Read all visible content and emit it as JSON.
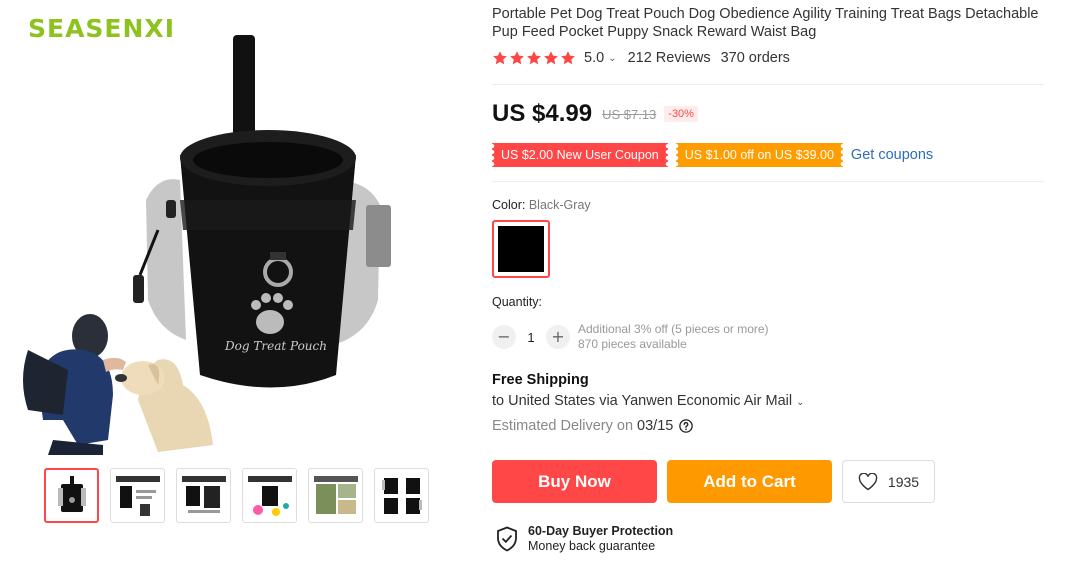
{
  "brand": {
    "logo_text": "SEASENXI"
  },
  "gallery": {
    "thumbnail_count": 6,
    "active_index": 0,
    "main_image_label": "Dog Treat Pouch"
  },
  "product": {
    "title": "Portable Pet Dog Treat Pouch Dog Obedience Agility Training Treat Bags Detachable Pup Feed Pocket Puppy Snack Reward Waist Bag",
    "rating": "5.0",
    "star_count": 5,
    "reviews": "212 Reviews",
    "orders": "370 orders"
  },
  "price": {
    "current": "US $4.99",
    "original": "US $7.13",
    "discount": "-30%"
  },
  "coupons": {
    "new_user": "US $2.00 New User Coupon",
    "store": "US $1.00 off on US $39.00",
    "get_link": "Get coupons"
  },
  "color": {
    "label": "Color: ",
    "value": "Black-Gray",
    "swatch_color": "#000000"
  },
  "quantity": {
    "label": "Quantity:",
    "value": "1",
    "minus": "−",
    "plus": "+",
    "note_discount": "Additional 3% off (5 pieces or more)",
    "note_available": "870 pieces available"
  },
  "shipping": {
    "title": "Free Shipping",
    "method": "to United States via Yanwen Economic Air Mail",
    "delivery_label": "Estimated Delivery on",
    "delivery_date": "03/15"
  },
  "actions": {
    "buy_now": "Buy Now",
    "add_to_cart": "Add to Cart",
    "wishlist_count": "1935"
  },
  "protection": {
    "title": "60-Day Buyer Protection",
    "subtitle": "Money back guarantee"
  },
  "colors": {
    "accent_red": "#ff4747",
    "accent_orange": "#ff9900",
    "link_blue": "#2e6db5",
    "star": "#ff4747"
  }
}
